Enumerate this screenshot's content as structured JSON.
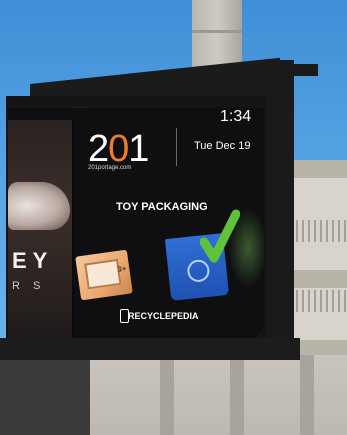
{
  "photo": {
    "description_kind": "outdoor digital billboard photo"
  },
  "billboard": {
    "left_ad": {
      "big_text": "EY",
      "small_text": "R S"
    },
    "logo_text_parts": [
      "2",
      "0",
      "1"
    ],
    "logo_url": "201portage.com",
    "time": "1:34",
    "date": "Tue Dec 19",
    "headline": "TOY PACKAGING",
    "toybox_label": "3+",
    "brand": "RECYCLEPEDIA"
  },
  "colors": {
    "sky": "#4c9ad9",
    "logo_accent": "#f07b2c",
    "bin_blue": "#2f6fd6",
    "check_green": "#5fc23a"
  },
  "icons": [
    "check-mark-icon",
    "recycle-bin-icon",
    "phone-icon"
  ]
}
